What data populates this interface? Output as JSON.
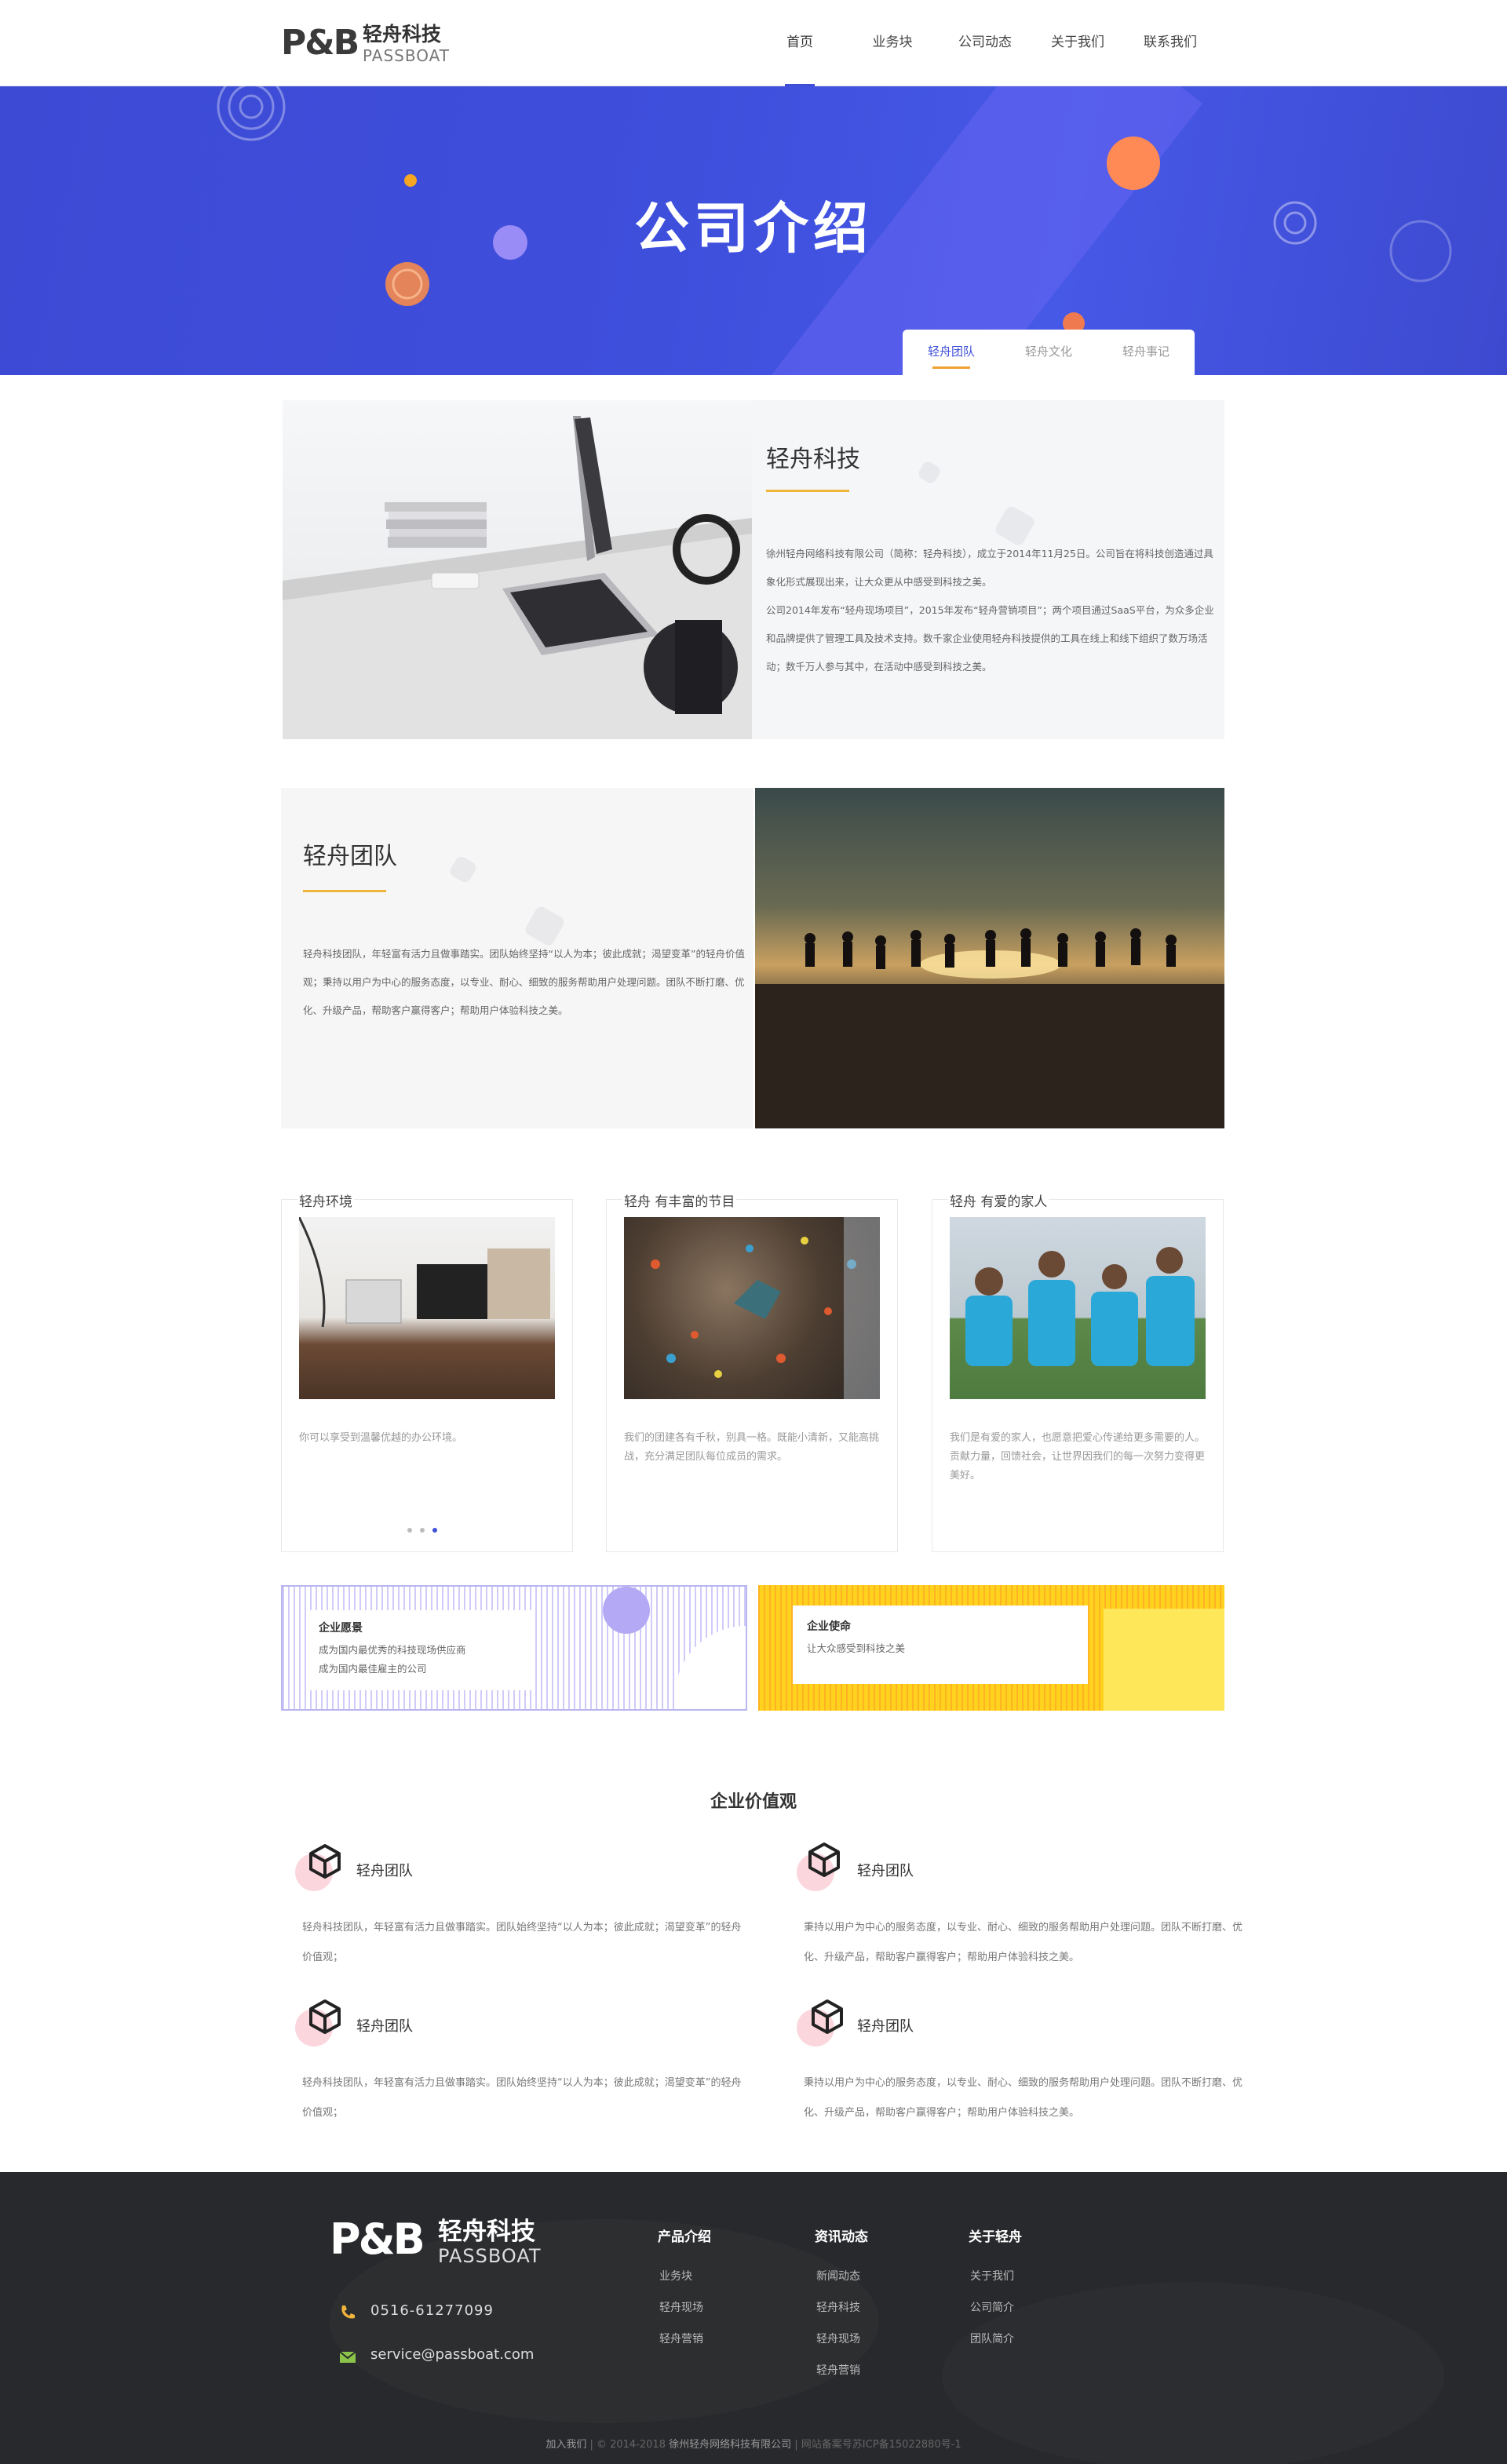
{
  "header": {
    "logo_mark": "P&B",
    "logo_cn": "轻舟科技",
    "logo_en": "PASSBOAT",
    "nav": [
      "首页",
      "业务块",
      "公司动态",
      "关于我们",
      "联系我们"
    ],
    "active_nav": 0
  },
  "banner": {
    "title": "公司介绍",
    "tabs": [
      "轻舟团队",
      "轻舟文化",
      "轻舟事记"
    ]
  },
  "intro": {
    "title": "轻舟科技",
    "paragraphs": [
      "徐州轻舟网络科技有限公司（简称：轻舟科技），成立于2014年11月25日。公司旨在将科技创造通过具象化形式展现出来，让大众更从中感受到科技之美。",
      "公司2014年发布“轻舟现场项目”，2015年发布“轻舟营销项目”；两个项目通过SaaS平台，为众多企业和品牌提供了管理工具及技术支持。数千家企业使用轻舟科技提供的工具在线上和线下组织了数万场活动；数千万人参与其中，在活动中感受到科技之美。"
    ]
  },
  "team": {
    "title": "轻舟团队",
    "text": "轻舟科技团队，年轻富有活力且做事踏实。团队始终坚持“以人为本；彼此成就；渴望变革”的轻舟价值观；秉持以用户为中心的服务态度，以专业、耐心、细致的服务帮助用户处理问题。团队不断打磨、优化、升级产品，帮助客户赢得客户；帮助用户体验科技之美。"
  },
  "cards": [
    {
      "title": "轻舟环境",
      "text": "你可以享受到温馨优越的办公环境。"
    },
    {
      "title": "轻舟    有丰富的节目",
      "text": "我们的团建各有千秋，别具一格。既能小清新，又能高挑战，充分满足团队每位成员的需求。"
    },
    {
      "title": "轻舟    有爱的家人",
      "text": "我们是有爱的家人，也愿意把爱心传递给更多需要的人。贡献力量，回馈社会，让世界因我们的每一次努力变得更美好。"
    }
  ],
  "banners": {
    "vision": {
      "title": "企业愿景",
      "lines": [
        "成为国内最优秀的科技现场供应商",
        "成为国内最佳雇主的公司"
      ]
    },
    "mission": {
      "title": "企业使命",
      "lines": [
        "让大众感受到科技之美"
      ]
    }
  },
  "values": {
    "title": "企业价值观",
    "items": [
      {
        "title": "轻舟团队",
        "text": "轻舟科技团队，年轻富有活力且做事踏实。团队始终坚持“以人为本；彼此成就；渴望变革”的轻舟价值观；"
      },
      {
        "title": "轻舟团队",
        "text": "秉持以用户为中心的服务态度，以专业、耐心、细致的服务帮助用户处理问题。团队不断打磨、优化、升级产品，帮助客户赢得客户；帮助用户体验科技之美。"
      },
      {
        "title": "轻舟团队",
        "text": "轻舟科技团队，年轻富有活力且做事踏实。团队始终坚持“以人为本；彼此成就；渴望变革”的轻舟价值观；"
      },
      {
        "title": "轻舟团队",
        "text": "秉持以用户为中心的服务态度，以专业、耐心、细致的服务帮助用户处理问题。团队不断打磨、优化、升级产品，帮助客户赢得客户；帮助用户体验科技之美。"
      }
    ]
  },
  "footer": {
    "logo_mark": "P&B",
    "logo_cn": "轻舟科技",
    "logo_en": "PASSBOAT",
    "phone": "0516-61277099",
    "email": "service@passboat.com",
    "columns": [
      {
        "title": "产品介绍",
        "items": [
          "业务块",
          "轻舟现场",
          "轻舟营销"
        ]
      },
      {
        "title": "资讯动态",
        "items": [
          "新闻动态",
          "轻舟科技",
          "轻舟现场",
          "轻舟营销"
        ]
      },
      {
        "title": "关于轻舟",
        "items": [
          "关于我们",
          "公司简介",
          "团队简介"
        ]
      }
    ],
    "copyright": {
      "join": "加入我们",
      "years": "© 2014-2018",
      "company": "徐州轻舟网络科技有限公司",
      "icp": "网站备案号苏ICP备15022880号-1"
    }
  },
  "colors": {
    "brand": "#3f4fd8",
    "accent": "#f0b43c",
    "mission_yellow": "#ffd21e",
    "footer_bg": "#27292c"
  }
}
